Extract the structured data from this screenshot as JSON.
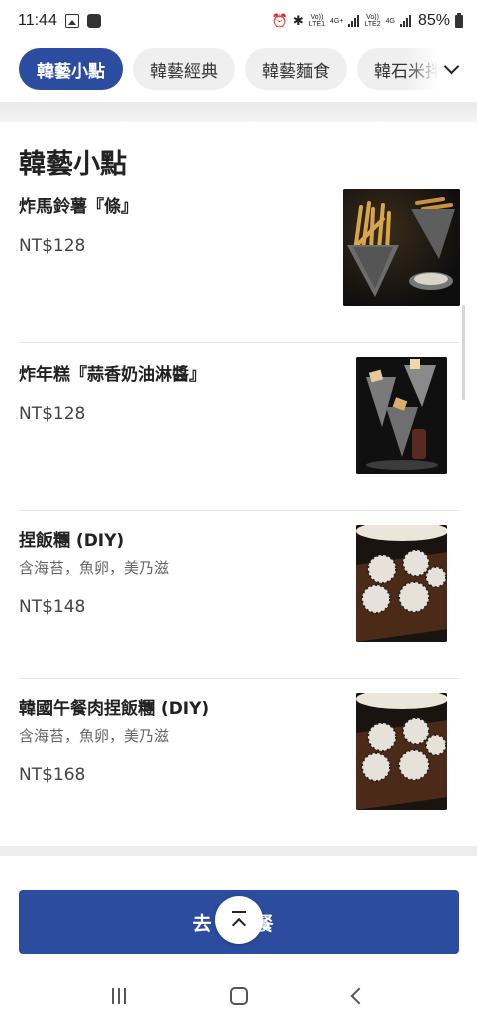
{
  "status_bar": {
    "time": "11:44",
    "network_1": "Vo))",
    "network_1_sub": "LTE1",
    "network_1_type": "4G+",
    "network_2": "Vo))",
    "network_2_sub": "LTE2",
    "network_2_type": "4G",
    "battery": "85%"
  },
  "tabs": {
    "items": [
      {
        "label": "韓藝小點",
        "active": true
      },
      {
        "label": "韓藝經典",
        "active": false
      },
      {
        "label": "韓藝麵食",
        "active": false
      },
      {
        "label": "韓石米拌",
        "active": false
      }
    ]
  },
  "section": {
    "title": "韓藝小點"
  },
  "items": [
    {
      "name": "炸馬鈴薯『條』",
      "description": "",
      "price": "NT$128",
      "image": "fries-photo"
    },
    {
      "name": "炸年糕『蒜香奶油淋醬』",
      "description": "",
      "price": "NT$128",
      "image": "rice-cake-photo"
    },
    {
      "name": "捏飯糰 (DIY)",
      "description": "含海苔，魚卵，美乃滋",
      "price": "NT$148",
      "image": "rice-ball-photo"
    },
    {
      "name": "韓國午餐肉捏飯糰 (DIY)",
      "description": "含海苔，魚卵，美乃滋",
      "price": "NT$168",
      "image": "spam-rice-ball-photo"
    }
  ],
  "cart_button": {
    "label": "去點餐"
  },
  "icons": {
    "tabs_expand": "chevron-down-icon",
    "scroll_top": "scroll-to-top-icon"
  },
  "colors": {
    "accent": "#2c4d9f"
  }
}
